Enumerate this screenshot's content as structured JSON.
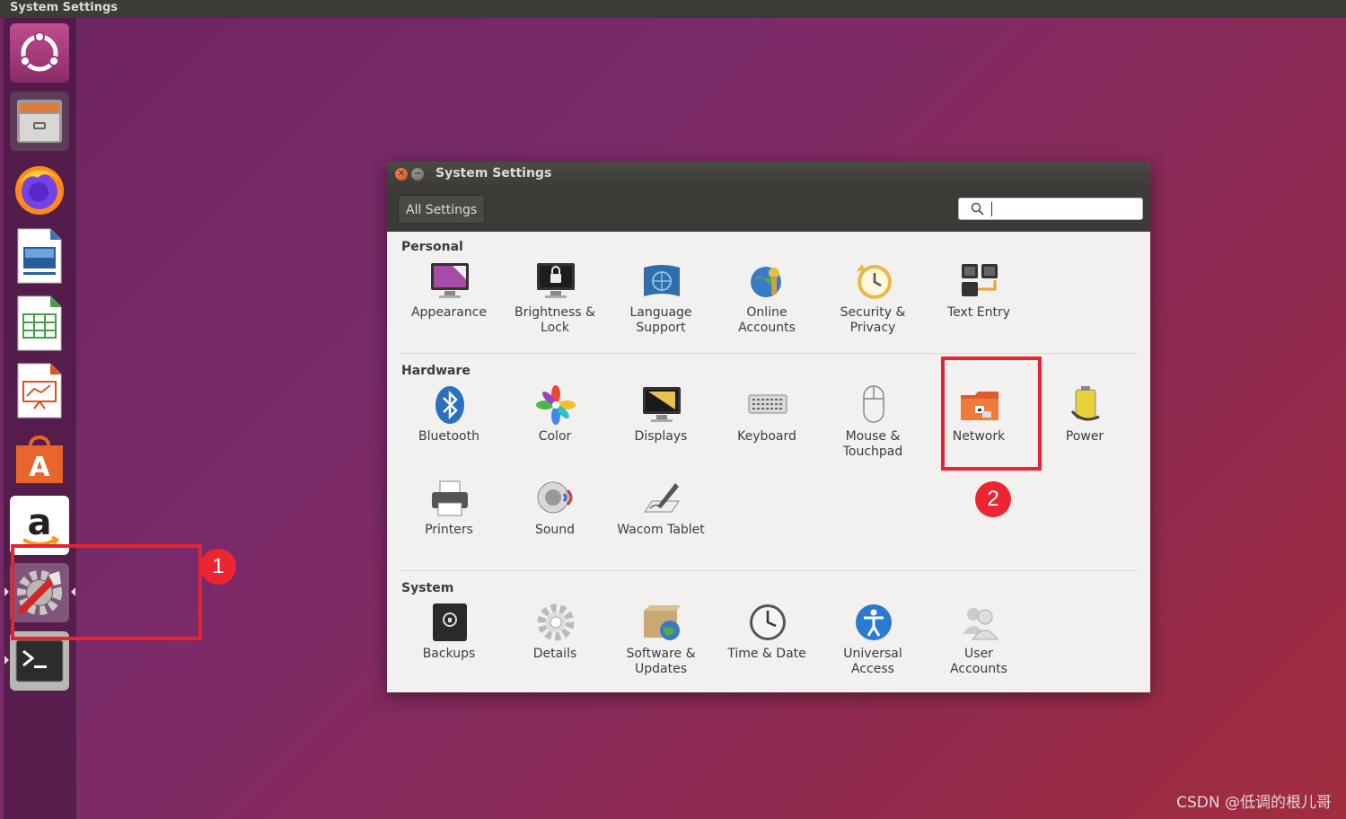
{
  "topbar": {
    "title": "System Settings"
  },
  "launcher": {
    "items": [
      {
        "name": "ubuntu-dash-icon"
      },
      {
        "name": "files-icon"
      },
      {
        "name": "firefox-icon"
      },
      {
        "name": "writer-icon"
      },
      {
        "name": "calc-icon"
      },
      {
        "name": "impress-icon"
      },
      {
        "name": "software-center-icon"
      },
      {
        "name": "amazon-icon"
      },
      {
        "name": "system-settings-icon"
      },
      {
        "name": "terminal-icon"
      }
    ]
  },
  "annotations": {
    "one": "1",
    "two": "2"
  },
  "window": {
    "title": "System Settings",
    "toolbar": {
      "all_settings": "All Settings"
    },
    "search": {
      "placeholder": ""
    },
    "sections": {
      "personal": {
        "title": "Personal",
        "items": [
          {
            "label1": "Appearance",
            "label2": ""
          },
          {
            "label1": "Brightness &",
            "label2": "Lock"
          },
          {
            "label1": "Language",
            "label2": "Support"
          },
          {
            "label1": "Online",
            "label2": "Accounts"
          },
          {
            "label1": "Security &",
            "label2": "Privacy"
          },
          {
            "label1": "Text Entry",
            "label2": ""
          }
        ]
      },
      "hardware": {
        "title": "Hardware",
        "items": [
          {
            "label1": "Bluetooth",
            "label2": ""
          },
          {
            "label1": "Color",
            "label2": ""
          },
          {
            "label1": "Displays",
            "label2": ""
          },
          {
            "label1": "Keyboard",
            "label2": ""
          },
          {
            "label1": "Mouse &",
            "label2": "Touchpad"
          },
          {
            "label1": "Network",
            "label2": ""
          },
          {
            "label1": "Power",
            "label2": ""
          },
          {
            "label1": "Printers",
            "label2": ""
          },
          {
            "label1": "Sound",
            "label2": ""
          },
          {
            "label1": "Wacom Tablet",
            "label2": ""
          }
        ]
      },
      "system": {
        "title": "System",
        "items": [
          {
            "label1": "Backups",
            "label2": ""
          },
          {
            "label1": "Details",
            "label2": ""
          },
          {
            "label1": "Software &",
            "label2": "Updates"
          },
          {
            "label1": "Time & Date",
            "label2": ""
          },
          {
            "label1": "Universal",
            "label2": "Access"
          },
          {
            "label1": "User",
            "label2": "Accounts"
          }
        ]
      }
    }
  },
  "watermark": "CSDN @低调的根儿哥"
}
